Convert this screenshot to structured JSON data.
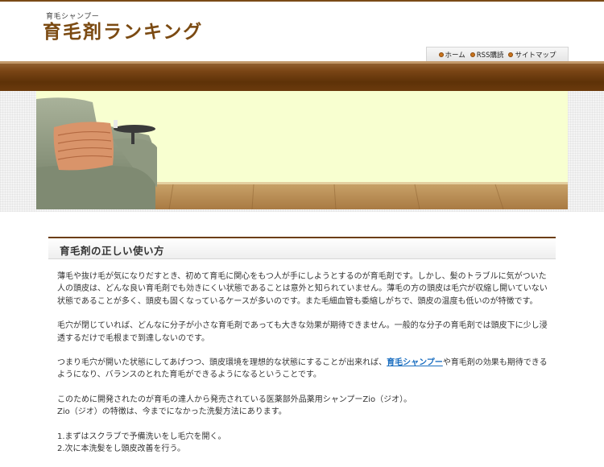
{
  "header": {
    "tagline": "育毛シャンプー",
    "title": "育毛剤ランキング"
  },
  "nav": [
    {
      "label": "ホーム",
      "icon": "bullet-icon"
    },
    {
      "label": "RSS購読",
      "icon": "bullet-icon"
    },
    {
      "label": "サイトマップ",
      "icon": "bullet-icon"
    }
  ],
  "colors": {
    "brand_brown": "#7b4a12",
    "band_brown": "#6b3a0d",
    "link_blue": "#1a6ec0",
    "hero_wall": "#f8ffd0"
  },
  "section": {
    "title": "育毛剤の正しい使い方"
  },
  "article": {
    "p1": "薄毛や抜け毛が気になりだすとき、初めて育毛に関心をもつ人が手にしようとするのが育毛剤です。しかし、髪のトラブルに気がついた人の頭皮は、どんな良い育毛剤でも効きにくい状態であることは意外と知られていません。薄毛の方の頭皮は毛穴が収縮し開いていない状態であることが多く、頭皮も固くなっているケースが多いのです。また毛細血管も委縮しがちで、頭皮の温度も低いのが特徴です。",
    "p2": "毛穴が閉じていれば、どんなに分子が小さな育毛剤であっても大きな効果が期待できません。一般的な分子の育毛剤では頭皮下に少し浸透するだけで毛根まで到達しないのです。",
    "p3_before": "つまり毛穴が開いた状態にしてあげつつ、頭皮環境を理想的な状態にすることが出来れば、",
    "p3_link": "育毛シャンプー",
    "p3_after": "や育毛剤の効果も期待できるようになり、バランスのとれた育毛ができるようになるということです。",
    "p4_line1": "このために開発されたのが育毛の達人から発売されている医薬部外品薬用シャンプーZio（ジオ）。",
    "p4_line2": "Zio（ジオ）の特徴は、今までになかった洗髪方法にあります。",
    "list_1": "1.まずはスクラブで予備洗いをし毛穴を開く。",
    "list_2": "2.次に本洗髪をし頭皮改善を行う。"
  }
}
